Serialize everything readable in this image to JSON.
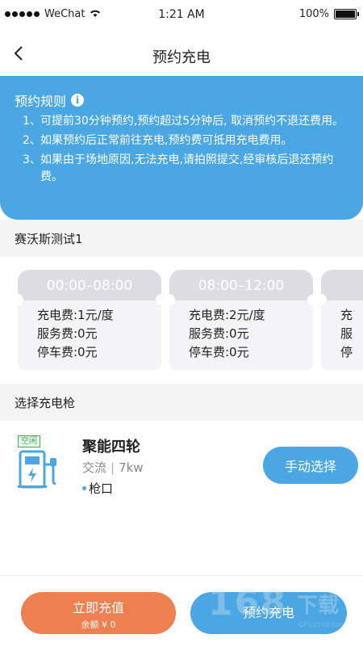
{
  "status_bar": {
    "carrier": "WeChat",
    "time": "1:21 AM",
    "battery": "100%"
  },
  "nav": {
    "title": "预约充电",
    "back_icon": "chevron-left-icon"
  },
  "rules": {
    "title": "预约规则",
    "info_icon": "info-icon",
    "items": [
      {
        "num": "1、",
        "text": "可提前30分钟预约,预约超过5分钟后, 取消预约不退还费用。"
      },
      {
        "num": "2、",
        "text": "如果预约后正常前往充电,预约费可抵用充电费用。"
      },
      {
        "num": "3、",
        "text": "如果由于场地原因,无法充电,请拍照提交,经审核后退还预约费。"
      }
    ]
  },
  "station": {
    "name": "赛沃斯测试1"
  },
  "tariffs": [
    {
      "time": "00:00–08:00",
      "charge_fee": "充电费:1元/度",
      "service_fee": "服务费:0元",
      "parking_fee": "停车费:0元"
    },
    {
      "time": "08:00–12:00",
      "charge_fee": "充电费:2元/度",
      "service_fee": "服务费:0元",
      "parking_fee": "停车费:0元"
    },
    {
      "time": "",
      "charge_fee": "充",
      "service_fee": "服",
      "parking_fee": "停"
    }
  ],
  "gun_section": {
    "title": "选择充电枪"
  },
  "gun": {
    "status": "空闲",
    "name": "聚能四轮",
    "type": "交流",
    "power": "7kw",
    "port": "枪口",
    "icon": "charging-station-icon",
    "manual_select_label": "手动选择"
  },
  "footer": {
    "recharge_label": "立即充值",
    "balance": "余额 ¥ 0",
    "reserve_label": "预约充电"
  },
  "watermark": {
    "big": "168",
    "cn": "下载",
    "url": "GPS.JI168.com"
  },
  "colors": {
    "primary": "#4aa7e4",
    "orange": "#ee7f50",
    "idle_green": "#3cae5a"
  }
}
